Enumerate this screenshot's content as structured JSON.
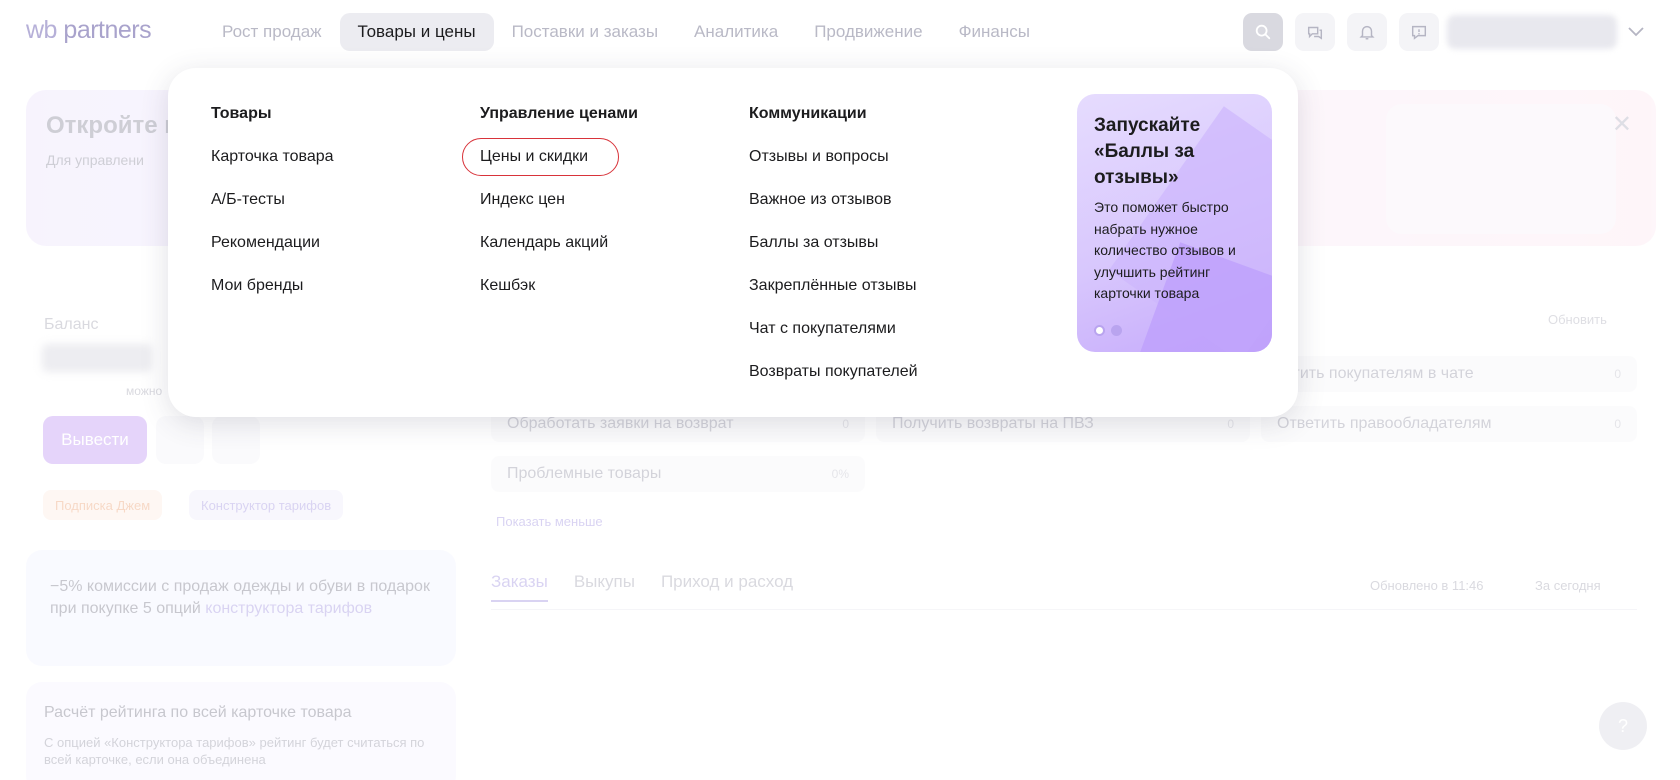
{
  "logo": {
    "brand": "wb",
    "name": "partners"
  },
  "nav": [
    {
      "label": "Рост продаж",
      "active": false
    },
    {
      "label": "Товары и цены",
      "active": true
    },
    {
      "label": "Поставки и заказы",
      "active": false
    },
    {
      "label": "Аналитика",
      "active": false
    },
    {
      "label": "Продвижение",
      "active": false
    },
    {
      "label": "Финансы",
      "active": false
    }
  ],
  "header_icons": [
    "search-icon",
    "chat-icon",
    "bell-icon",
    "feedback-icon"
  ],
  "background": {
    "banner": {
      "title": "Откройте к",
      "subtitle": "Для управлени"
    },
    "balance": {
      "label": "Баланс",
      "sub": "можно",
      "withdraw": "Вывести",
      "tags": [
        "Подписка Джем",
        "Конструктор тарифов"
      ]
    },
    "promo": {
      "text": "−5% комиссии с продаж одежды и обуви в подарок при покупке 5 опций ",
      "link": "конструктора тарифов"
    },
    "rating": {
      "title": "Расчёт рейтинга по всей карточке товара",
      "text": "С опцией «Конструктора тарифов» рейтинг будет считаться по всей карточке, если она объединена"
    },
    "refresh": "Обновить",
    "tasks": [
      {
        "label": "Обработать заявки на возврат",
        "count": "0"
      },
      {
        "label": "Получить возвраты на ПВЗ",
        "count": "0"
      },
      {
        "label": "Ответить правообладателям",
        "count": "0"
      },
      {
        "label": "Проблемные товары",
        "count": "0%"
      },
      {
        "label": "зетить покупателям в чате",
        "count": "0"
      }
    ],
    "show_less": "Показать меньше",
    "tabs": [
      "Заказы",
      "Выкупы",
      "Приход и расход"
    ],
    "updated": "Обновлено в 11:46",
    "period": "За сегодня",
    "help": "?"
  },
  "menu": {
    "col1": {
      "heading": "Товары",
      "links": [
        "Карточка товара",
        "А/Б-тесты",
        "Рекомендации",
        "Мои бренды"
      ]
    },
    "col2": {
      "heading": "Управление ценами",
      "links": [
        "Цены и скидки",
        "Индекс цен",
        "Календарь акций",
        "Кешбэк"
      ]
    },
    "col3": {
      "heading": "Коммуникации",
      "links": [
        "Отзывы и вопросы",
        "Важное из отзывов",
        "Баллы за отзывы",
        "Закреплённые отзывы",
        "Чат с покупателями",
        "Возвраты покупателей"
      ]
    },
    "promo": {
      "title": "Запускайте «Баллы за отзывы»",
      "text": "Это поможет быстро набрать нужное количество отзывов и улучшить рейтинг карточки товара",
      "slides": 2,
      "active_slide": 1
    }
  },
  "colors": {
    "accent": "#b07cf0",
    "highlight": "#d8333a",
    "nav_active_bg": "#ececf1"
  }
}
